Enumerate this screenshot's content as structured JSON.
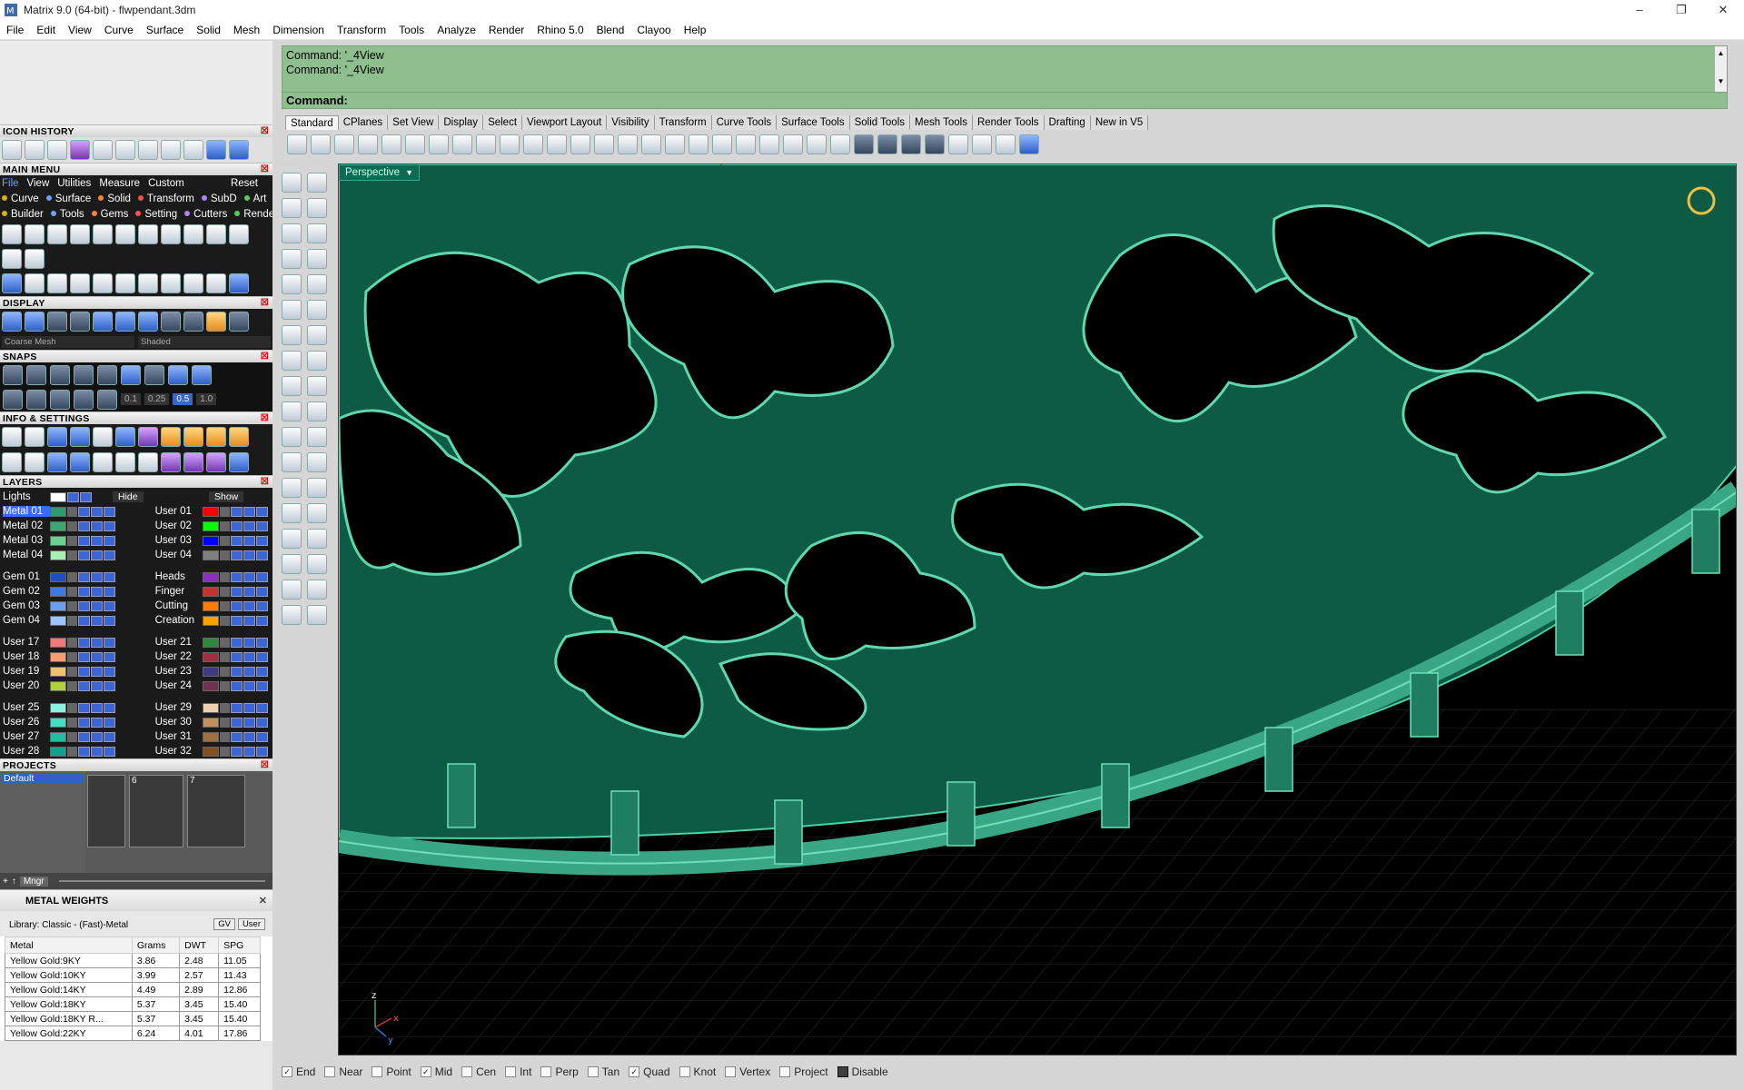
{
  "window": {
    "title": "Matrix 9.0 (64-bit) - flwpendant.3dm",
    "minimize": "–",
    "restore": "❐",
    "close": "✕"
  },
  "menubar": [
    "File",
    "Edit",
    "View",
    "Curve",
    "Surface",
    "Solid",
    "Mesh",
    "Dimension",
    "Transform",
    "Tools",
    "Analyze",
    "Render",
    "Rhino 5.0",
    "Blend",
    "Clayoo",
    "Help"
  ],
  "left": {
    "icon_history": "ICON HISTORY",
    "main_menu": "MAIN MENU",
    "mm_tabs": [
      "File",
      "View",
      "Utilities",
      "Measure",
      "Custom"
    ],
    "mm_reset": "Reset",
    "mm_cats_1": [
      "Curve",
      "Surface",
      "Solid",
      "Transform",
      "SubD",
      "Art"
    ],
    "mm_cats_2": [
      "Builder",
      "Tools",
      "Gems",
      "Setting",
      "Cutters",
      "Render"
    ],
    "display": "DISPLAY",
    "display_mesh": "Coarse Mesh",
    "display_mode": "Shaded",
    "snaps": "SNAPS",
    "snap_values": [
      "0.1",
      "0.25",
      "0.5",
      "1.0"
    ],
    "info_settings": "INFO & SETTINGS",
    "layers": "LAYERS",
    "lights": "Lights",
    "hide": "Hide",
    "show": "Show",
    "layer_rows": [
      [
        {
          "name": "Metal 01",
          "color": "#2e9a6e",
          "sel": true
        },
        {
          "name": "User 01",
          "color": "#ff0000"
        }
      ],
      [
        {
          "name": "Metal 02",
          "color": "#3aa870"
        },
        {
          "name": "User 02",
          "color": "#00ff00"
        }
      ],
      [
        {
          "name": "Metal 03",
          "color": "#6ed090"
        },
        {
          "name": "User 03",
          "color": "#0000ff"
        }
      ],
      [
        {
          "name": "Metal 04",
          "color": "#a6f0b6"
        },
        {
          "name": "User 04",
          "color": "#808080"
        }
      ],
      [
        {
          "name": "Gem 01",
          "color": "#1f4fbf"
        },
        {
          "name": "Heads",
          "color": "#8b2fbf"
        }
      ],
      [
        {
          "name": "Gem 02",
          "color": "#3b7ae0"
        },
        {
          "name": "Finger",
          "color": "#c83030"
        }
      ],
      [
        {
          "name": "Gem 03",
          "color": "#6aa0f0"
        },
        {
          "name": "Cutting",
          "color": "#ff7a00"
        }
      ],
      [
        {
          "name": "Gem 04",
          "color": "#9cc6ff"
        },
        {
          "name": "Creation",
          "color": "#ffa000"
        }
      ],
      [
        {
          "name": "User 17",
          "color": "#f07a7a"
        },
        {
          "name": "User 21",
          "color": "#2e8a3a"
        }
      ],
      [
        {
          "name": "User 18",
          "color": "#f0a070"
        },
        {
          "name": "User 22",
          "color": "#a03040"
        }
      ],
      [
        {
          "name": "User 19",
          "color": "#f0c070"
        },
        {
          "name": "User 23",
          "color": "#403a80"
        }
      ],
      [
        {
          "name": "User 20",
          "color": "#b0d040"
        },
        {
          "name": "User 24",
          "color": "#703050"
        }
      ],
      [
        {
          "name": "User 25",
          "color": "#90f0e0"
        },
        {
          "name": "User 29",
          "color": "#f0d0b0"
        }
      ],
      [
        {
          "name": "User 26",
          "color": "#40e0c0"
        },
        {
          "name": "User 30",
          "color": "#c09060"
        }
      ],
      [
        {
          "name": "User 27",
          "color": "#20c0a0"
        },
        {
          "name": "User 31",
          "color": "#a07040"
        }
      ],
      [
        {
          "name": "User 28",
          "color": "#10a090"
        },
        {
          "name": "User 32",
          "color": "#805020"
        }
      ]
    ],
    "projects": "PROJECTS",
    "project_default": "Default",
    "thumb_labels": [
      "",
      "6",
      "7"
    ],
    "mngr": "Mngr",
    "metal_weights": "METAL WEIGHTS",
    "library": "Library: Classic - (Fast)-Metal",
    "gv": "GV",
    "user": "User",
    "mw_headers": [
      "Metal",
      "Grams",
      "DWT",
      "SPG"
    ],
    "mw_rows": [
      [
        "Yellow Gold:9KY",
        "3.86",
        "2.48",
        "11.05"
      ],
      [
        "Yellow Gold:10KY",
        "3.99",
        "2.57",
        "11.43"
      ],
      [
        "Yellow Gold:14KY",
        "4.49",
        "2.89",
        "12.86"
      ],
      [
        "Yellow Gold:18KY",
        "5.37",
        "3.45",
        "15.40"
      ],
      [
        "Yellow Gold:18KY R...",
        "5.37",
        "3.45",
        "15.40"
      ],
      [
        "Yellow Gold:22KY",
        "6.24",
        "4.01",
        "17.86"
      ]
    ]
  },
  "command": {
    "history": [
      "Command: '_4View",
      "Command: '_4View"
    ],
    "prompt": "Command:"
  },
  "tabs": [
    "Standard",
    "CPlanes",
    "Set View",
    "Display",
    "Select",
    "Viewport Layout",
    "Visibility",
    "Transform",
    "Curve Tools",
    "Surface Tools",
    "Solid Tools",
    "Mesh Tools",
    "Render Tools",
    "Drafting",
    "New in V5"
  ],
  "viewport": {
    "label": "Perspective",
    "axis_z": "z",
    "axis_x": "x",
    "axis_y": "y",
    "model_color": "#0d5a45",
    "edge_color": "#4fd0a6"
  },
  "osnap": [
    {
      "label": "End",
      "on": true
    },
    {
      "label": "Near",
      "on": false
    },
    {
      "label": "Point",
      "on": false
    },
    {
      "label": "Mid",
      "on": true
    },
    {
      "label": "Cen",
      "on": false
    },
    {
      "label": "Int",
      "on": false
    },
    {
      "label": "Perp",
      "on": false
    },
    {
      "label": "Tan",
      "on": false
    },
    {
      "label": "Quad",
      "on": true
    },
    {
      "label": "Knot",
      "on": false
    },
    {
      "label": "Vertex",
      "on": false
    },
    {
      "label": "Project",
      "on": false
    },
    {
      "label": "Disable",
      "on": false
    }
  ]
}
